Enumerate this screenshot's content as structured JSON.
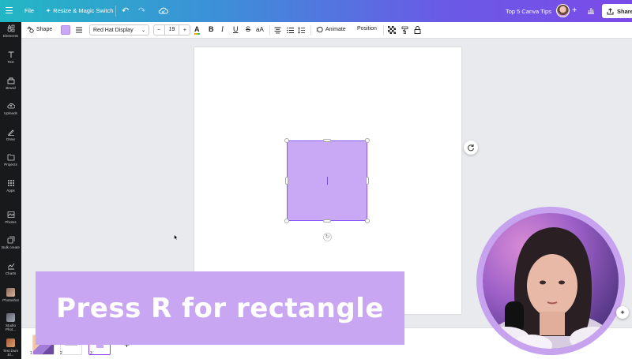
{
  "topbar": {
    "file_label": "File",
    "resize_label": "Resize & Magic Switch",
    "doc_title": "Top 5 Canva Tips",
    "share_label": "Share",
    "colors": {
      "gradient_start": "#22b7c4",
      "gradient_end": "#7b4ae8"
    }
  },
  "sidebar": {
    "items": [
      {
        "label": "Elements",
        "icon": "elements-icon"
      },
      {
        "label": "Text",
        "icon": "text-icon"
      },
      {
        "label": "Brand",
        "icon": "brand-icon"
      },
      {
        "label": "Uploads",
        "icon": "uploads-icon"
      },
      {
        "label": "Draw",
        "icon": "draw-icon"
      },
      {
        "label": "Projects",
        "icon": "projects-icon"
      },
      {
        "label": "Apps",
        "icon": "apps-icon"
      },
      {
        "label": "Photos",
        "icon": "photos-icon"
      },
      {
        "label": "Bulk create",
        "icon": "bulk-create-icon"
      },
      {
        "label": "Charts",
        "icon": "charts-icon"
      },
      {
        "label": "Photoshot",
        "icon": "app-thumbnail"
      },
      {
        "label": "Studio Phot...",
        "icon": "app-thumbnail"
      },
      {
        "label": "Text Dum El...",
        "icon": "app-thumbnail"
      }
    ]
  },
  "context_toolbar": {
    "shape_label": "Shape",
    "shape_color": "#c9a8f5",
    "font_name": "Red Hat Display",
    "font_size": "19",
    "minus_label": "−",
    "plus_label": "+",
    "bold_label": "B",
    "italic_label": "I",
    "underline_label": "U",
    "strike_label": "S",
    "case_label": "aA",
    "animate_label": "Animate",
    "position_label": "Position"
  },
  "canvas": {
    "rect_color": "#c9a8f5"
  },
  "pages": {
    "items": [
      {
        "number": "1"
      },
      {
        "number": "2"
      },
      {
        "number": "3"
      }
    ],
    "add_label": "+"
  },
  "caption": {
    "text": "Press R for rectangle",
    "color": "#c8a6f2"
  }
}
